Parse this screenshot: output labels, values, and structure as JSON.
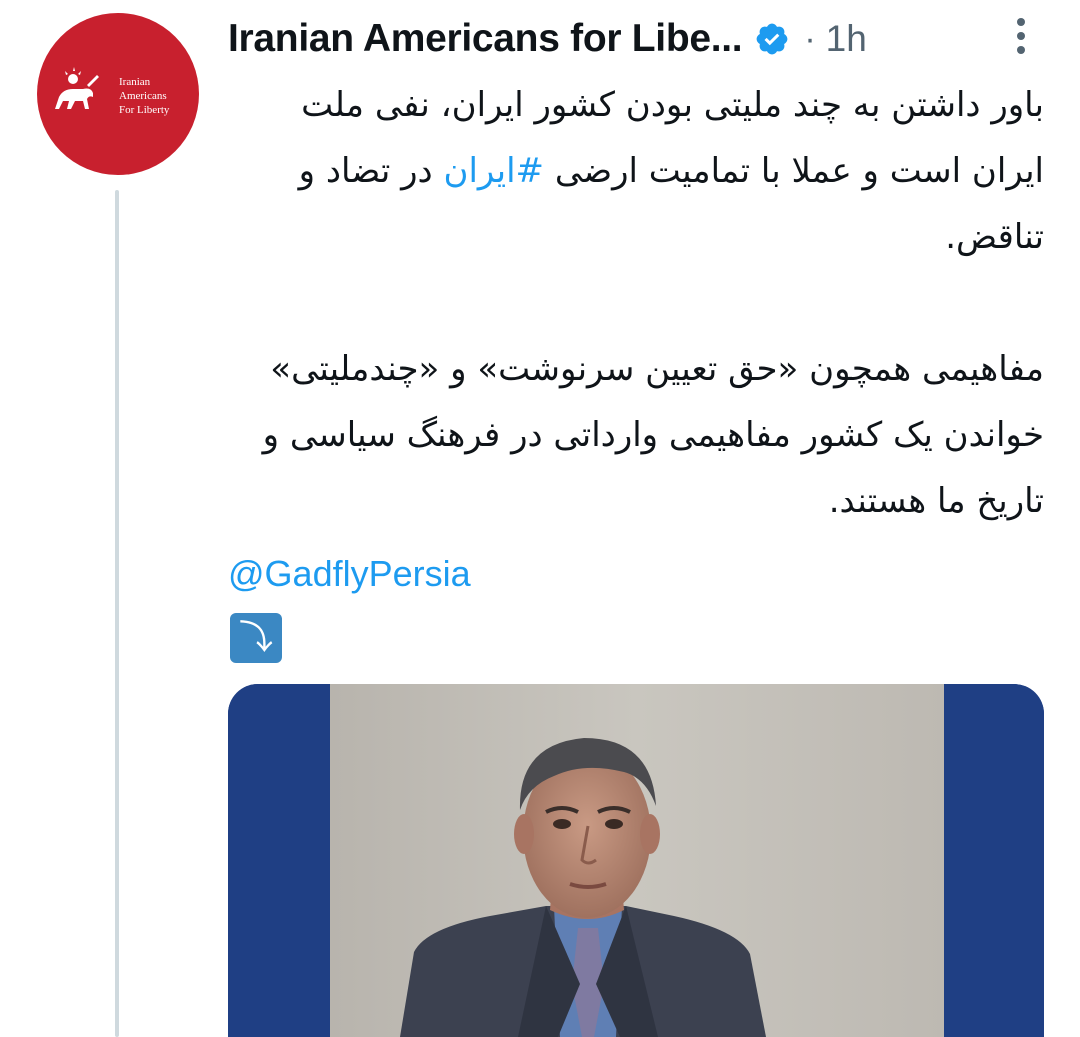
{
  "account": {
    "display_name": "Iranian Americans for Libe...",
    "verified": true,
    "separator": "·",
    "time": "1h",
    "avatar_lines": [
      "Iranian",
      "Americans",
      "For Liberty"
    ],
    "avatar_color": "#c8202e"
  },
  "tweet": {
    "paragraph1_part1": "باور داشتن به چند ملیتی بودن کشور ایران، نفی ملت ایران است و عملا با تمامیت ارضی ",
    "hashtag": "#ایران",
    "paragraph1_part2": " در تضاد و تناقض.",
    "paragraph2": "مفاهیمی همچون «حق تعیین سرنوشت» و «چندملیتی» خواندن یک کشور مفاهیمی وارداتی در فرهنگ سیاسی و تاریخ ما هستند.",
    "mention": "@GadflyPersia",
    "arrow_symbol": "⤵"
  },
  "icons": {
    "verified": "verified-badge-icon",
    "more": "more-options-icon",
    "arrow": "arrow-down-right-icon"
  },
  "colors": {
    "link": "#1d9bf0",
    "secondary_text": "#536471",
    "verified_badge": "#1d9bf0",
    "media_side_panel": "#1f3f84"
  }
}
